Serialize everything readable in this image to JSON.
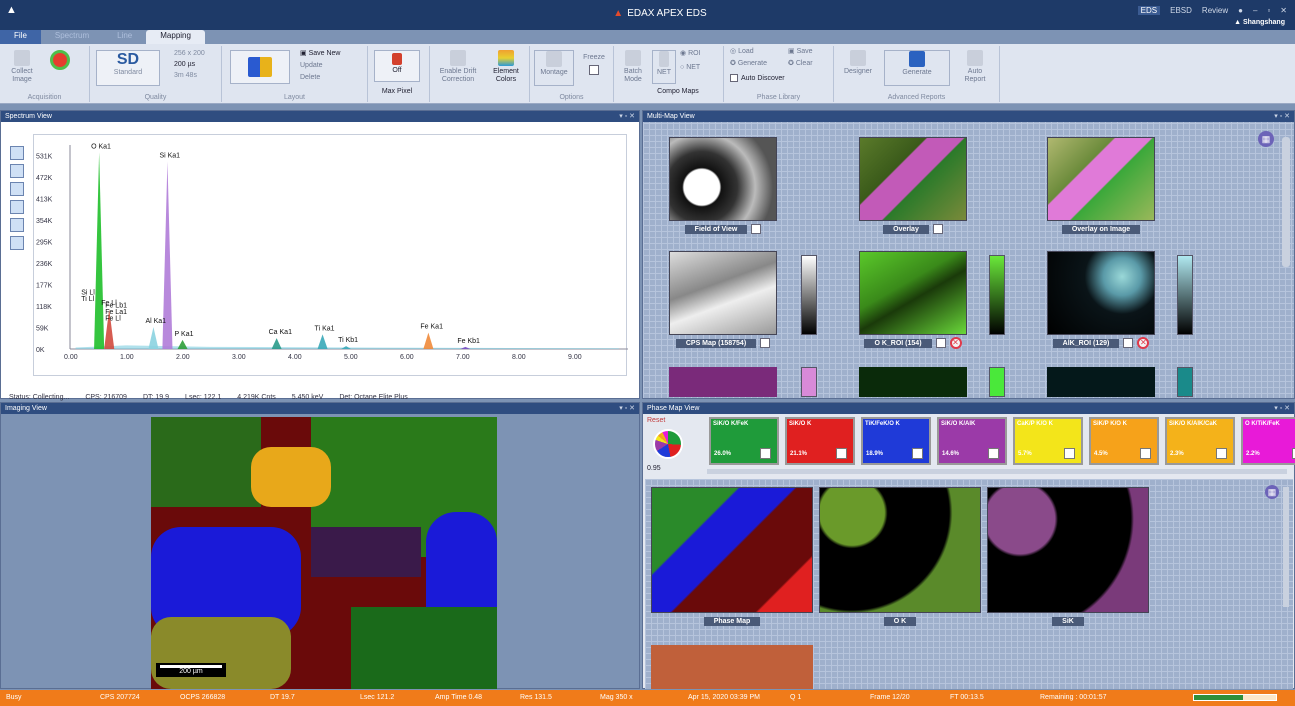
{
  "window": {
    "title": "EDAX APEX EDS",
    "buttons": [
      "EDS",
      "EBSD",
      "Review"
    ],
    "user": "Shangshang"
  },
  "tabs": [
    "File",
    "Spectrum",
    "Line",
    "Mapping"
  ],
  "ribbon": {
    "collect_image": "Collect Image",
    "acquisition": "Acquisition",
    "sd": "SD",
    "standard": "Standard",
    "res": "256 x 200",
    "dwell": "200 µs",
    "time": "3m 48s",
    "quality": "Quality",
    "save_new": "Save New",
    "update": "Update",
    "delete": "Delete",
    "layout": "Layout",
    "off": "Off",
    "max_pixel": "Max Pixel",
    "enable_drift": "Enable Drift Correction",
    "element_colors": "Element Colors",
    "montage": "Montage",
    "freeze": "Freeze",
    "options": "Options",
    "batch_mode": "Batch Mode",
    "net": "NET",
    "roi": "ROI",
    "compo_maps": "Compo Maps",
    "load": "Load",
    "save": "Save",
    "generate": "Generate",
    "clear": "Clear",
    "auto_discover": "Auto Discover",
    "phase_library": "Phase Library",
    "designer": "Designer",
    "generate2": "Generate",
    "auto_report": "Auto Report",
    "advanced_reports": "Advanced Reports"
  },
  "spectrum_view": {
    "title": "Spectrum View",
    "status": "Status: Collecting...",
    "cps": "CPS: 216709",
    "dt": "DT: 19.9",
    "lsec": "Lsec: 122.1",
    "cnts": "4.219K Cnts",
    "kev": "5.450 keV",
    "det": "Det: Octane Elite Plus"
  },
  "chart_data": {
    "type": "line",
    "xlabel": "",
    "ylabel": "",
    "x_ticks": [
      "0.00",
      "1.00",
      "2.00",
      "3.00",
      "4.00",
      "5.00",
      "6.00",
      "7.00",
      "8.00",
      "9.00"
    ],
    "y_ticks": [
      "0K",
      "59K",
      "118K",
      "177K",
      "236K",
      "295K",
      "354K",
      "413K",
      "472K",
      "531K"
    ],
    "xlim": [
      0,
      10
    ],
    "ylim": [
      0,
      560
    ],
    "peaks": [
      {
        "label": "O Ka1",
        "x": 0.52,
        "y": 540,
        "color": "#1fbf2a"
      },
      {
        "label": "Si Ka1",
        "x": 1.74,
        "y": 515,
        "color": "#b07cd8"
      },
      {
        "label": "Fe Ll",
        "x": 0.7,
        "y": 110,
        "color": "#d24a3e"
      },
      {
        "label": "Al Ka1",
        "x": 1.49,
        "y": 60,
        "color": "#8bd3e0"
      },
      {
        "label": "P Ka1",
        "x": 2.01,
        "y": 25,
        "color": "#2f9e3a"
      },
      {
        "label": "Ca Ka1",
        "x": 3.69,
        "y": 30,
        "color": "#2a9a8a"
      },
      {
        "label": "Ti Ka1",
        "x": 4.51,
        "y": 40,
        "color": "#3aa9b8"
      },
      {
        "label": "Ti Kb1",
        "x": 4.93,
        "y": 8,
        "color": "#3aa9b8"
      },
      {
        "label": "Fe Ka1",
        "x": 6.4,
        "y": 45,
        "color": "#f08a3a"
      },
      {
        "label": "Fe Kb1",
        "x": 7.06,
        "y": 6,
        "color": "#7a4cc2"
      }
    ],
    "other_labels": [
      "Si Ll",
      "Ti Ll",
      "Fe Lb1",
      "Fe La1",
      "Fe Ll"
    ]
  },
  "multimap_view": {
    "title": "Multi-Map View",
    "maps": [
      "Field of View",
      "Overlay",
      "Overlay on Image",
      "CPS Map (158754)",
      "O K_ROI (154)",
      "AlK_ROI (129)"
    ]
  },
  "imaging_view": {
    "title": "Imaging View",
    "scale": "200 µm"
  },
  "phasemap_view": {
    "title": "Phase Map View",
    "reset": "Reset",
    "threshold": "0.95",
    "phases": [
      {
        "name": "SiK/O K/FeK",
        "pct": "26.0%",
        "color": "#1f9b3a"
      },
      {
        "name": "SiK/O K",
        "pct": "21.1%",
        "color": "#e02020"
      },
      {
        "name": "TiK/FeK/O K",
        "pct": "18.9%",
        "color": "#1f3ad8"
      },
      {
        "name": "SiK/O K/AlK",
        "pct": "14.6%",
        "color": "#9b3aa8"
      },
      {
        "name": "CaK/P K/O K",
        "pct": "5.7%",
        "color": "#f3e51a"
      },
      {
        "name": "SiK/P K/O K",
        "pct": "4.5%",
        "color": "#f6a21a"
      },
      {
        "name": "SiK/O K/AlK/CaK",
        "pct": "2.3%",
        "color": "#f4b21a"
      },
      {
        "name": "O K/TiK/FeK",
        "pct": "2.2%",
        "color": "#e81ad8"
      }
    ],
    "maps": [
      "Phase Map",
      "O K",
      "SiK"
    ]
  },
  "statusbar": {
    "state": "Busy",
    "cps": "CPS 207724",
    "ocps": "OCPS 266828",
    "dt": "DT 19.7",
    "lsec": "Lsec 121.2",
    "amp": "Amp Time 0.48",
    "res": "Res 131.5",
    "mag": "Mag 350 x",
    "date": "Apr 15, 2020 03:39 PM",
    "q": "Q 1",
    "frame": "Frame 12/20",
    "ft": "FT 00:13.5",
    "remaining": "Remaining : 00:01:57",
    "progress": 0.6
  }
}
